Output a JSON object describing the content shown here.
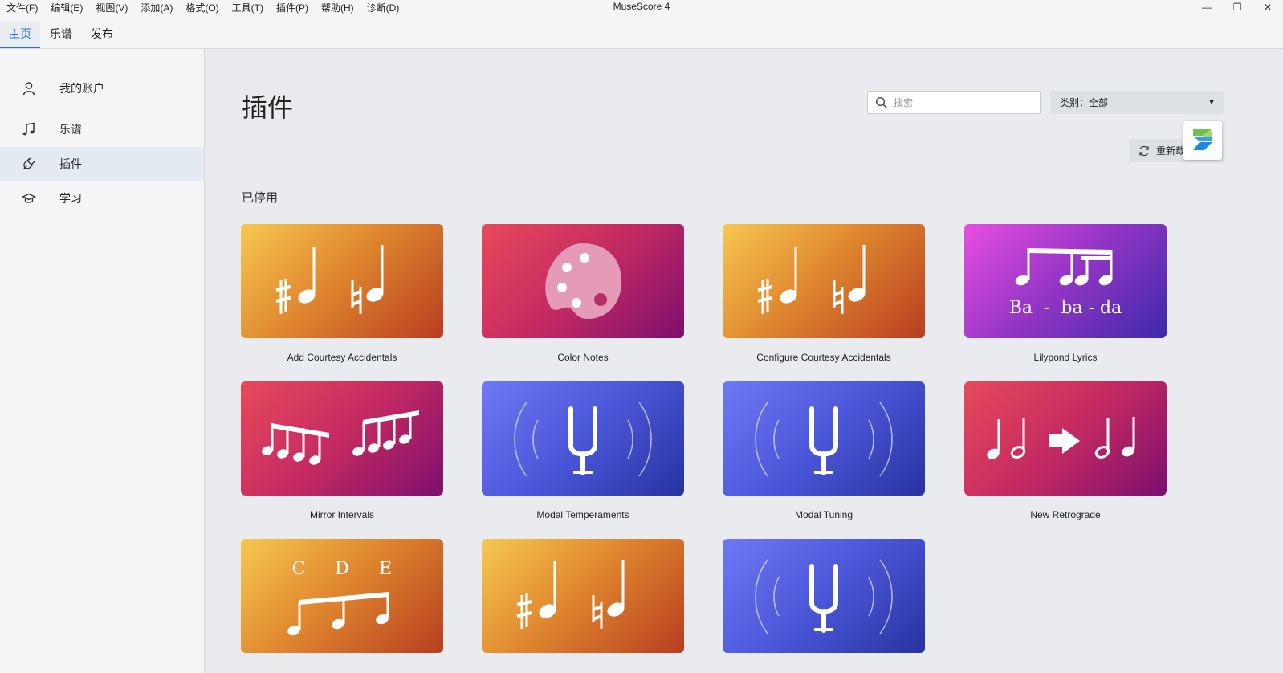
{
  "window": {
    "title": "MuseScore 4",
    "menu": [
      "文件(F)",
      "编辑(E)",
      "视图(V)",
      "添加(A)",
      "格式(O)",
      "工具(T)",
      "插件(P)",
      "帮助(H)",
      "诊断(D)"
    ],
    "controls": {
      "minimize": "—",
      "restore": "❐",
      "close": "✕"
    }
  },
  "topnav": {
    "tabs": [
      {
        "label": "主页",
        "active": true
      },
      {
        "label": "乐谱",
        "active": false
      },
      {
        "label": "发布",
        "active": false
      }
    ]
  },
  "sidebar": {
    "items": [
      {
        "label": "我的账户",
        "icon": "user-icon",
        "active": false
      },
      {
        "label": "乐谱",
        "icon": "music-note-icon",
        "active": false
      },
      {
        "label": "插件",
        "icon": "plugin-icon",
        "active": true
      },
      {
        "label": "学习",
        "icon": "graduation-cap-icon",
        "active": false
      }
    ]
  },
  "main": {
    "title": "插件",
    "search": {
      "placeholder": "搜索",
      "value": ""
    },
    "category": {
      "label": "类别：",
      "value": "全部"
    },
    "reload": {
      "label": "重新载"
    },
    "section_title": "已停用",
    "plugins": [
      {
        "name": "Add Courtesy Accidentals",
        "theme": "orange",
        "art": "accidentals-art"
      },
      {
        "name": "Color Notes",
        "theme": "red",
        "art": "palette-art"
      },
      {
        "name": "Configure Courtesy Accidentals",
        "theme": "orange",
        "art": "accidentals-art"
      },
      {
        "name": "Lilypond Lyrics",
        "theme": "purple",
        "art": "lyrics-art",
        "art_text": "Ba  -  ba - da"
      },
      {
        "name": "Mirror Intervals",
        "theme": "red",
        "art": "mirror-art"
      },
      {
        "name": "Modal Temperaments",
        "theme": "blue",
        "art": "tuning-fork-art"
      },
      {
        "name": "Modal Tuning",
        "theme": "blue",
        "art": "tuning-fork-art"
      },
      {
        "name": "New Retrograde",
        "theme": "red",
        "art": "retrograde-art"
      },
      {
        "name": "",
        "theme": "orange",
        "art": "note-names-art",
        "art_text": [
          "C",
          "D",
          "E"
        ]
      },
      {
        "name": "",
        "theme": "orange",
        "art": "accidentals-art"
      },
      {
        "name": "",
        "theme": "blue",
        "art": "tuning-fork-art"
      }
    ]
  }
}
